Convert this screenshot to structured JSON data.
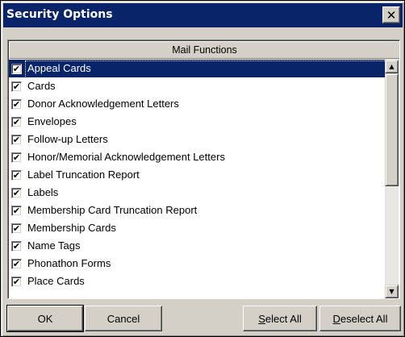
{
  "window": {
    "title": "Security Options",
    "close_glyph": "✕"
  },
  "list": {
    "column_header": "Mail Functions",
    "check_glyph": "✔",
    "items": [
      {
        "label": "Appeal Cards",
        "checked": true,
        "selected": true
      },
      {
        "label": "Cards",
        "checked": true,
        "selected": false
      },
      {
        "label": "Donor Acknowledgement Letters",
        "checked": true,
        "selected": false
      },
      {
        "label": "Envelopes",
        "checked": true,
        "selected": false
      },
      {
        "label": "Follow-up Letters",
        "checked": true,
        "selected": false
      },
      {
        "label": "Honor/Memorial Acknowledgement Letters",
        "checked": true,
        "selected": false
      },
      {
        "label": "Label Truncation Report",
        "checked": true,
        "selected": false
      },
      {
        "label": "Labels",
        "checked": true,
        "selected": false
      },
      {
        "label": "Membership Card Truncation Report",
        "checked": true,
        "selected": false
      },
      {
        "label": "Membership Cards",
        "checked": true,
        "selected": false
      },
      {
        "label": "Name Tags",
        "checked": true,
        "selected": false
      },
      {
        "label": "Phonathon Forms",
        "checked": true,
        "selected": false
      },
      {
        "label": "Place Cards",
        "checked": true,
        "selected": false
      }
    ],
    "scroll_up_glyph": "▲",
    "scroll_down_glyph": "▼"
  },
  "buttons": {
    "ok": "OK",
    "cancel": "Cancel",
    "select_all_mnemonic": "S",
    "select_all_rest": "elect All",
    "deselect_all_mnemonic": "D",
    "deselect_all_rest": "eselect All"
  },
  "colors": {
    "titlebar": "#0a246a",
    "face": "#d4d0c8",
    "selection": "#0a246a"
  }
}
